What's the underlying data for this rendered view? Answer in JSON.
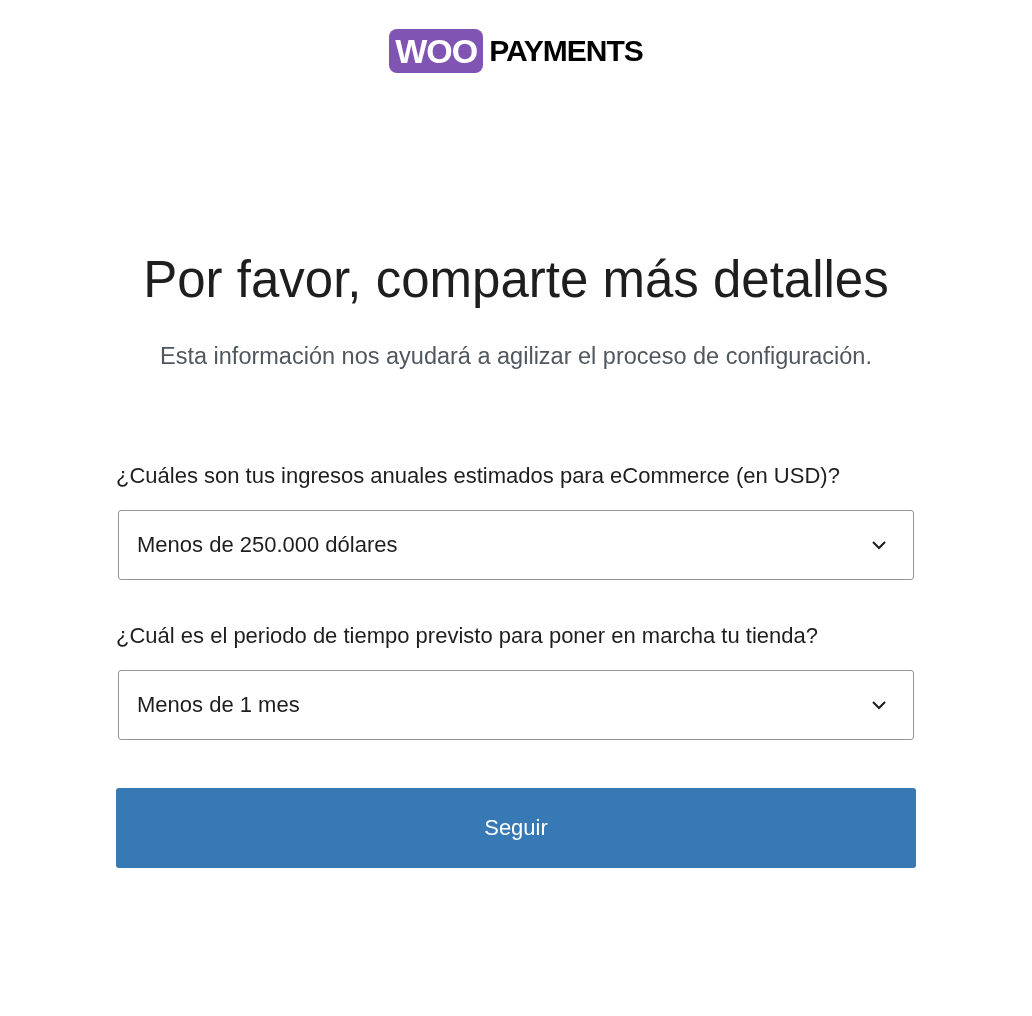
{
  "logo": {
    "badge": "WOO",
    "wordmark": "PAYMENTS"
  },
  "heading": "Por favor, comparte más detalles",
  "subtitle": "Esta información nos ayudará a agilizar el proceso de configuración.",
  "questions": [
    {
      "label": "¿Cuáles son tus ingresos anuales estimados para eCommerce (en USD)?",
      "value": "Menos de 250.000 dólares"
    },
    {
      "label": "¿Cuál es el periodo de tiempo previsto para poner en marcha tu tienda?",
      "value": "Menos de 1 mes"
    }
  ],
  "submit_button": "Seguir"
}
